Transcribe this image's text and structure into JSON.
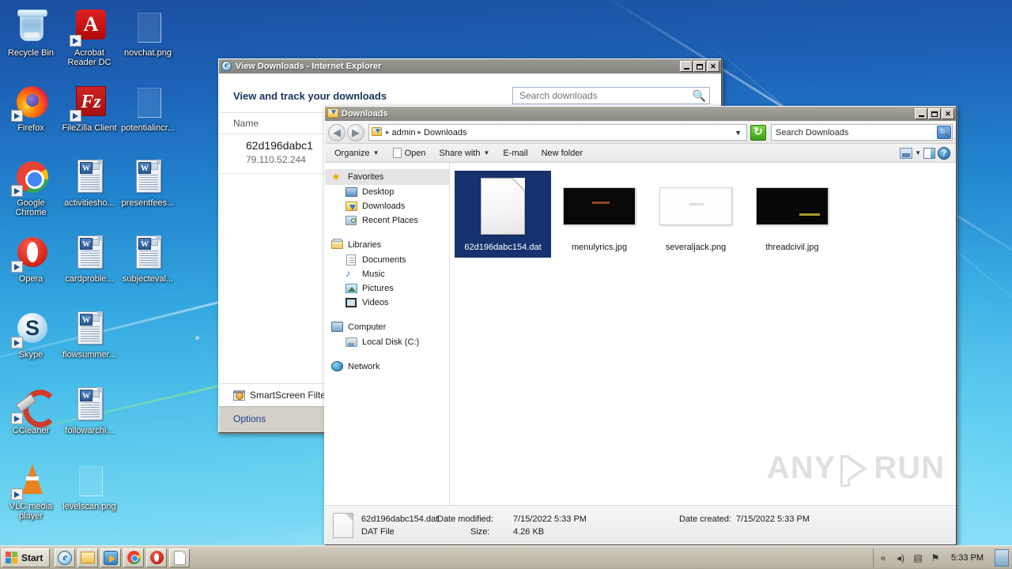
{
  "desktop": {
    "icons": [
      {
        "label": "Recycle Bin",
        "type": "recycle-bin"
      },
      {
        "label": "Acrobat Reader DC",
        "type": "acrobat"
      },
      {
        "label": "novchat.png",
        "type": "png-file"
      },
      {
        "label": "Firefox",
        "type": "firefox"
      },
      {
        "label": "FileZilla Client",
        "type": "filezilla"
      },
      {
        "label": "potentialincr...",
        "type": "png-file"
      },
      {
        "label": "Google Chrome",
        "type": "chrome"
      },
      {
        "label": "activitiesho...",
        "type": "word-doc"
      },
      {
        "label": "presentfees...",
        "type": "word-doc"
      },
      {
        "label": "Opera",
        "type": "opera"
      },
      {
        "label": "cardproble...",
        "type": "word-doc"
      },
      {
        "label": "subjecteval...",
        "type": "word-doc"
      },
      {
        "label": "Skype",
        "type": "skype"
      },
      {
        "label": "flowsummer...",
        "type": "word-doc"
      },
      {
        "label": "CCleaner",
        "type": "ccleaner"
      },
      {
        "label": "followarchi...",
        "type": "word-doc"
      },
      {
        "label": "VLC media player",
        "type": "vlc"
      },
      {
        "label": "levelscan.png",
        "type": "png-file"
      }
    ]
  },
  "ie_window": {
    "title": "View Downloads - Internet Explorer",
    "icon": "internet-explorer-icon",
    "heading": "View and track your downloads",
    "search": {
      "placeholder": "Search downloads",
      "value": "",
      "icon": "search-icon"
    },
    "column_header": "Name",
    "download": {
      "name": "62d196dabc1",
      "host": "79.110.52.244"
    },
    "smartscreen_label": "SmartScreen Filte",
    "options_label": "Options",
    "buttons": {
      "minimize": "minimize",
      "maximize": "maximize",
      "close": "close"
    }
  },
  "explorer_window": {
    "title": "Downloads",
    "icon": "downloads-folder-icon",
    "nav": {
      "back_label": "Back",
      "forward_label": "Forward",
      "address_icon": "downloads-folder-icon",
      "breadcrumbs": [
        "admin",
        "Downloads"
      ],
      "dropdown_icon": "chevron-down-icon",
      "refresh_icon": "refresh-icon",
      "search": {
        "placeholder": "Search Downloads",
        "value": "Search Downloads",
        "icon": "search-icon"
      }
    },
    "toolbar": {
      "organize": "Organize",
      "open": "Open",
      "share_with": "Share with",
      "email": "E-mail",
      "new_folder": "New folder",
      "view_icon": "view-layout-icon",
      "view_caret": "chevron-down-icon",
      "preview_pane_icon": "preview-pane-icon",
      "help_icon": "help-icon",
      "help_glyph": "?"
    },
    "sidebar": [
      {
        "root": "Favorites",
        "root_icon": "star-icon",
        "selected": true,
        "children": [
          {
            "label": "Desktop",
            "icon": "desktop-icon"
          },
          {
            "label": "Downloads",
            "icon": "downloads-folder-icon"
          },
          {
            "label": "Recent Places",
            "icon": "recent-places-icon"
          }
        ]
      },
      {
        "root": "Libraries",
        "root_icon": "libraries-icon",
        "selected": false,
        "children": [
          {
            "label": "Documents",
            "icon": "documents-icon"
          },
          {
            "label": "Music",
            "icon": "music-icon"
          },
          {
            "label": "Pictures",
            "icon": "pictures-icon"
          },
          {
            "label": "Videos",
            "icon": "videos-icon"
          }
        ]
      },
      {
        "root": "Computer",
        "root_icon": "computer-icon",
        "selected": false,
        "children": [
          {
            "label": "Local Disk (C:)",
            "icon": "hard-disk-icon"
          }
        ]
      },
      {
        "root": "Network",
        "root_icon": "network-icon",
        "selected": false,
        "children": []
      }
    ],
    "files": [
      {
        "name": "62d196dabc154.dat",
        "kind": "dat",
        "selected": true,
        "thumb_bg": "#f2f2f2"
      },
      {
        "name": "menulyrics.jpg",
        "kind": "image",
        "selected": false,
        "thumb_bg": "#0a0806",
        "thumb_text": "",
        "thumb_text_color": "#8a4a1e"
      },
      {
        "name": "severaljack.png",
        "kind": "image",
        "selected": false,
        "thumb_bg": "#fdfdfd",
        "thumb_text": "",
        "thumb_text_color": "#d8d8d8"
      },
      {
        "name": "threadcivil.jpg",
        "kind": "image",
        "selected": false,
        "thumb_bg": "#070707",
        "thumb_text": "",
        "thumb_text_color": "#a89a30"
      }
    ],
    "status": {
      "file_name": "62d196dabc154.dat",
      "file_type": "DAT File",
      "date_modified_label": "Date modified:",
      "date_modified_value": "7/15/2022 5:33 PM",
      "size_label": "Size:",
      "size_value": "4.26 KB",
      "date_created_label": "Date created:",
      "date_created_value": "7/15/2022 5:33 PM"
    },
    "buttons": {
      "minimize": "minimize",
      "maximize": "maximize",
      "close": "close"
    }
  },
  "watermark": {
    "text_left": "ANY",
    "text_right": "RUN",
    "icon": "play-button-icon"
  },
  "taskbar": {
    "start_label": "Start",
    "start_icon": "windows-logo-icon",
    "quick_launch": [
      {
        "name": "internet-explorer-icon"
      },
      {
        "name": "windows-explorer-icon"
      },
      {
        "name": "media-player-icon"
      },
      {
        "name": "chrome-icon"
      },
      {
        "name": "opera-icon"
      },
      {
        "name": "file-icon"
      }
    ],
    "tray": [
      {
        "name": "show-hidden-icons-icon",
        "glyph": "«"
      },
      {
        "name": "volume-icon",
        "glyph": "◂)"
      },
      {
        "name": "network-warning-icon",
        "glyph": "▤"
      },
      {
        "name": "action-center-flag-icon",
        "glyph": "⚑"
      }
    ],
    "clock": "5:33 PM",
    "show_desktop": "show-desktop-button"
  }
}
